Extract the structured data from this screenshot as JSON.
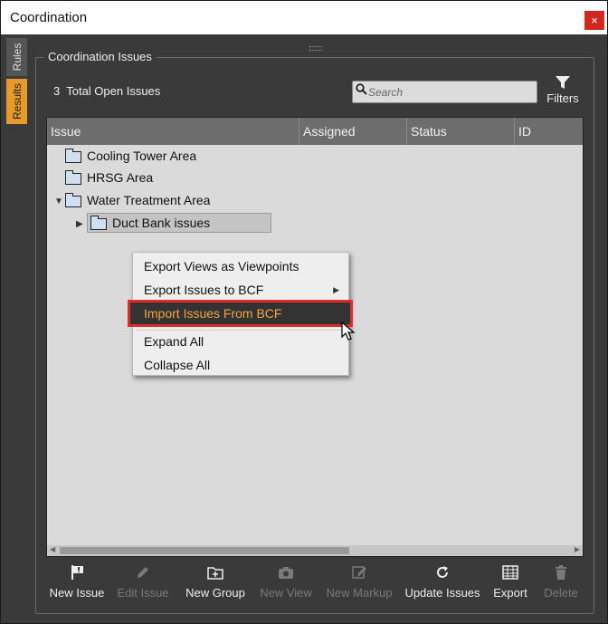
{
  "window": {
    "title": "Coordination",
    "close_glyph": "×"
  },
  "side_tabs": {
    "rules": "Rules",
    "results": "Results"
  },
  "group": {
    "label": "Coordination Issues"
  },
  "summary": {
    "count": "3",
    "text": "Total Open Issues"
  },
  "search": {
    "placeholder": "Search"
  },
  "filters": {
    "label": "Filters"
  },
  "table": {
    "columns": [
      "Issue",
      "Assigned",
      "Status",
      "ID"
    ],
    "rows": [
      {
        "label": "Cooling Tower Area",
        "expander": ""
      },
      {
        "label": "HRSG Area",
        "expander": ""
      },
      {
        "label": "Water Treatment Area",
        "expander": "▼"
      },
      {
        "label": "Duct Bank issues",
        "expander": "▶"
      }
    ]
  },
  "context_menu": {
    "items": [
      "Export Views as Viewpoints",
      "Export Issues to BCF",
      "Import Issues From BCF",
      "Expand All",
      "Collapse All"
    ],
    "submenu_glyph": "▶"
  },
  "toolbar": [
    {
      "label": "New Issue",
      "icon": "flag-icon",
      "enabled": true
    },
    {
      "label": "Edit Issue",
      "icon": "pencil-icon",
      "enabled": false
    },
    {
      "label": "New Group",
      "icon": "new-folder-icon",
      "enabled": true
    },
    {
      "label": "New View",
      "icon": "camera-icon",
      "enabled": false
    },
    {
      "label": "New Markup",
      "icon": "markup-icon",
      "enabled": false
    },
    {
      "label": "Update Issues",
      "icon": "refresh-icon",
      "enabled": true
    },
    {
      "label": "Export",
      "icon": "grid-icon",
      "enabled": true
    },
    {
      "label": "Delete",
      "icon": "trash-icon",
      "enabled": false
    }
  ],
  "colors": {
    "accent": "#e69a2a",
    "highlight_border": "#e02b2b",
    "panel_bg": "#3a3a3a"
  }
}
